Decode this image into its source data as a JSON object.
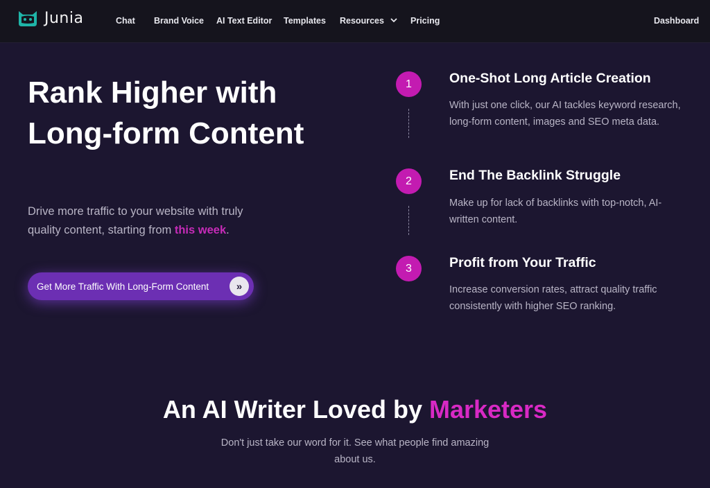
{
  "nav": {
    "brand": "Junia",
    "links": [
      "Chat",
      "Brand Voice",
      "AI Text Editor",
      "Templates",
      "Resources",
      "Pricing"
    ],
    "dashboard": "Dashboard"
  },
  "hero": {
    "title": "Rank Higher with Long-form Content",
    "subtitle_text": "Drive more traffic to your website with truly quality content, starting from ",
    "subtitle_accent": "this week",
    "subtitle_end": ".",
    "cta_label": "Get More Traffic With Long-Form Content",
    "cta_icon": "»"
  },
  "steps": [
    {
      "number": "1",
      "title": "One-Shot Long Article Creation",
      "description": "With just one click, our AI tackles keyword research, long-form content, images and SEO meta data."
    },
    {
      "number": "2",
      "title": "End The Backlink Struggle",
      "description": "Make up for lack of backlinks with top-notch, AI-written content."
    },
    {
      "number": "3",
      "title": "Profit from Your Traffic",
      "description": "Increase conversion rates, attract quality traffic consistently with higher SEO ranking."
    }
  ],
  "testimonials": {
    "title_start": "An AI Writer Loved by ",
    "title_accent": "Marketers",
    "subtitle": "Don't just take our word for it. See what people find amazing about us."
  },
  "colors": {
    "background": "#1c1630",
    "nav_background": "#15141d",
    "accent_magenta": "#c31bb1",
    "cta_purple": "#6c2fb3"
  }
}
